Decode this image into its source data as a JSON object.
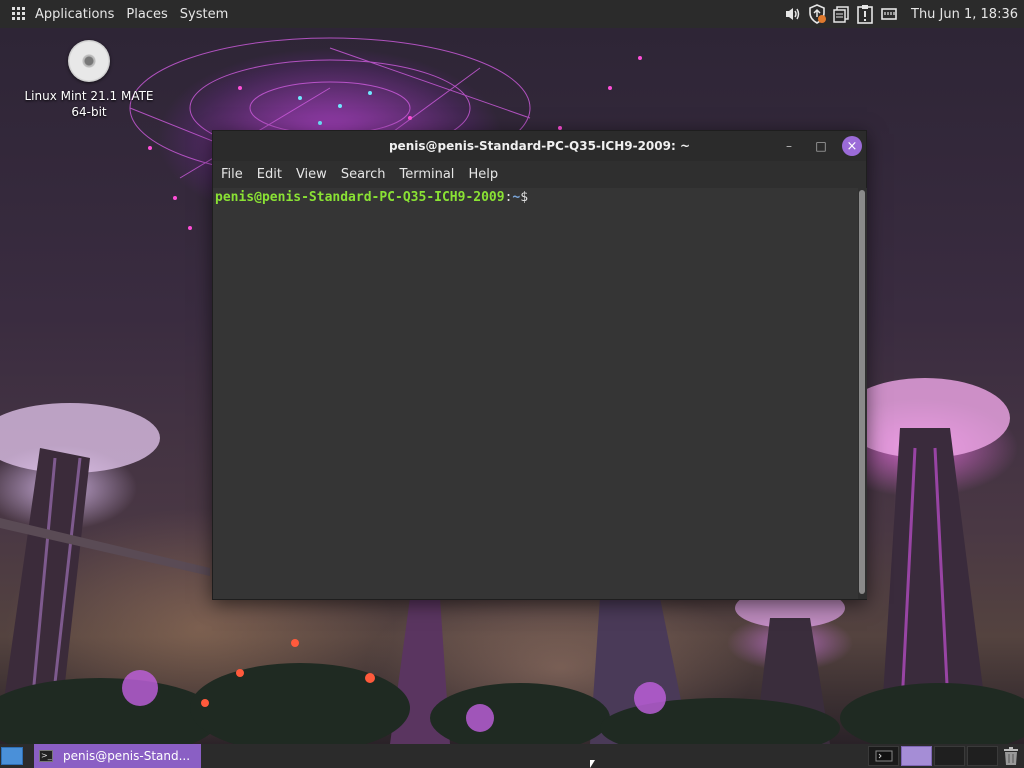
{
  "top_panel": {
    "menus": [
      "Applications",
      "Places",
      "System"
    ],
    "tray_icons": [
      "volume-icon",
      "shield-update-icon",
      "clipboard-icon",
      "notification-icon",
      "network-icon"
    ],
    "clock": "Thu Jun  1, 18:36"
  },
  "desktop": {
    "icons": [
      {
        "name": "disc-icon",
        "label_line1": "Linux Mint 21.1 MATE",
        "label_line2": "64-bit"
      }
    ]
  },
  "terminal": {
    "title": "penis@penis-Standard-PC-Q35-ICH9-2009: ~",
    "controls": {
      "minimize": "–",
      "maximize": "□",
      "close": "×"
    },
    "menu": [
      "File",
      "Edit",
      "View",
      "Search",
      "Terminal",
      "Help"
    ],
    "prompt": {
      "user_host": "penis@penis-Standard-PC-Q35-ICH9-2009",
      "separator": ":",
      "path": "~",
      "dollar": "$"
    }
  },
  "bottom_panel": {
    "task_label": "penis@penis-Stand...",
    "workspaces": 4,
    "active_workspace": 2
  },
  "colors": {
    "panel": "#2b2b2b",
    "accent": "#8a5fc4",
    "prompt_user": "#8ae234",
    "prompt_path": "#7aa6da",
    "close_button": "#9b6bd8"
  }
}
